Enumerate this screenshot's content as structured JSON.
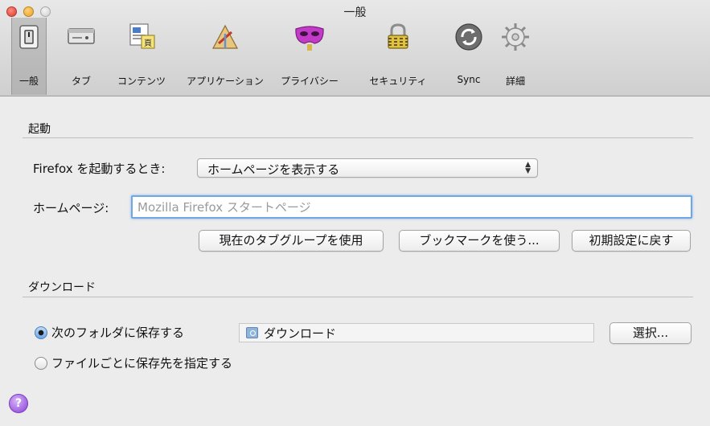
{
  "window": {
    "title": "一般"
  },
  "toolbar": {
    "items": [
      {
        "label": "一般",
        "icon": "switch-icon"
      },
      {
        "label": "タブ",
        "icon": "tab-icon"
      },
      {
        "label": "コンテンツ",
        "icon": "content-icon"
      },
      {
        "label": "アプリケーション",
        "icon": "applications-icon"
      },
      {
        "label": "プライバシー",
        "icon": "privacy-mask-icon"
      },
      {
        "label": "セキュリティ",
        "icon": "padlock-icon"
      },
      {
        "label": "Sync",
        "icon": "sync-icon"
      },
      {
        "label": "詳細",
        "icon": "gear-icon"
      }
    ]
  },
  "startup": {
    "section_title": "起動",
    "when_starts_label": "Firefox を起動するとき:",
    "when_starts_value": "ホームページを表示する",
    "homepage_label": "ホームページ:",
    "homepage_placeholder": "Mozilla Firefox スタートページ",
    "use_current_button": "現在のタブグループを使用",
    "use_bookmark_button": "ブックマークを使う...",
    "restore_default_button": "初期設定に戻す"
  },
  "downloads": {
    "section_title": "ダウンロード",
    "save_to_label": "次のフォルダに保存する",
    "folder_name": "ダウンロード",
    "choose_button": "選択...",
    "always_ask_label": "ファイルごとに保存先を指定する"
  },
  "help": {
    "symbol": "?"
  },
  "colors": {
    "focus_ring": "#6fa6e6",
    "help_button": "#8a3fd6"
  }
}
